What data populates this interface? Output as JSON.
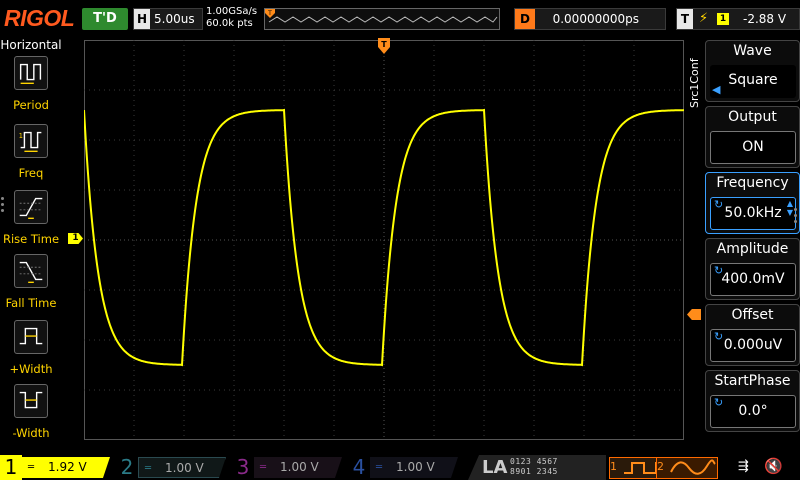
{
  "topbar": {
    "logo": "RIGOL",
    "trigger_status": "T'D",
    "horizontal_label": "H",
    "timebase": "5.00us",
    "sample_rate": "1.00GSa/s",
    "memory_depth": "60.0k pts",
    "delay_label": "D",
    "delay": "0.00000000ps",
    "trigger_label": "T",
    "trigger_edge": "rising",
    "trigger_source": "1",
    "trigger_level": "-2.88 V"
  },
  "left_menu": {
    "title": "Horizontal",
    "items": [
      {
        "label": "Period",
        "icon": "period-icon"
      },
      {
        "label": "Freq",
        "icon": "frequency-icon"
      },
      {
        "label": "Rise Time",
        "icon": "rise-time-icon"
      },
      {
        "label": "Fall Time",
        "icon": "fall-time-icon"
      },
      {
        "label": "+Width",
        "icon": "positive-width-icon"
      },
      {
        "label": "-Width",
        "icon": "negative-width-icon"
      }
    ]
  },
  "right_menu": {
    "source_label": "Src1Conf",
    "items": [
      {
        "header": "Wave",
        "value": "Square",
        "control": "arrow"
      },
      {
        "header": "Output",
        "value": "ON",
        "control": "none"
      },
      {
        "header": "Frequency",
        "value": "50.0kHz",
        "control": "knob",
        "active": true
      },
      {
        "header": "Amplitude",
        "value": "400.0mV",
        "control": "knob"
      },
      {
        "header": "Offset",
        "value": "0.000uV",
        "control": "knob"
      },
      {
        "header": "StartPhase",
        "value": "0.0°",
        "control": "knob"
      }
    ]
  },
  "screen": {
    "ch1_marker": "1",
    "colors": {
      "trace": "#ffff00",
      "grid": "#3a3a3a",
      "trigger": "#ff8c1a"
    }
  },
  "bottombar": {
    "channels": [
      {
        "number": "1",
        "scale": "1.92 V",
        "color": "#ffff00"
      },
      {
        "number": "2",
        "scale": "1.00 V",
        "color": "#2a7a86"
      },
      {
        "number": "3",
        "scale": "1.00 V",
        "color": "#8a2a8a"
      },
      {
        "number": "4",
        "scale": "1.00 V",
        "color": "#2a50a0"
      }
    ],
    "la_label": "LA",
    "la_bits_top": "0123 4567",
    "la_bits_bottom": "8901 2345",
    "gen1_number": "1",
    "gen2_number": "2"
  }
}
